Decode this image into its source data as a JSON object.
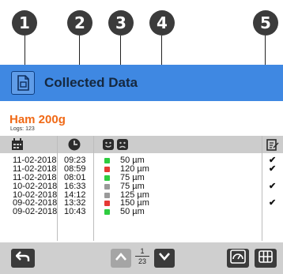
{
  "callouts": [
    "1",
    "2",
    "3",
    "4",
    "5"
  ],
  "title": "Collected Data",
  "product": {
    "name": "Ham 200g",
    "logs_label": "Logs: 123"
  },
  "table": {
    "header_icons": [
      "calendar-icon",
      "clock-icon",
      "smiley-icon",
      "frowny-icon",
      "edit-icon"
    ],
    "rows": [
      {
        "date": "11-02-2018",
        "time": "09:23",
        "status": "green",
        "value": "50 µm",
        "check": "✔"
      },
      {
        "date": "11-02-2018",
        "time": "08:59",
        "status": "red",
        "value": "120 µm",
        "check": "✔"
      },
      {
        "date": "11-02-2018",
        "time": "08:01",
        "status": "green",
        "value": "75 µm",
        "check": ""
      },
      {
        "date": "10-02-2018",
        "time": "16:33",
        "status": "gray",
        "value": "75 µm",
        "check": "✔"
      },
      {
        "date": "10-02-2018",
        "time": "14:12",
        "status": "gray",
        "value": "125 µm",
        "check": ""
      },
      {
        "date": "09-02-2018",
        "time": "13:32",
        "status": "red",
        "value": "150 µm",
        "check": "✔"
      },
      {
        "date": "09-02-2018",
        "time": "10:43",
        "status": "green",
        "value": "50 µm",
        "check": ""
      }
    ]
  },
  "pagination": {
    "current": "1",
    "total": "23"
  },
  "colors": {
    "titlebar": "#3f88e2",
    "product": "#f06a17",
    "green": "#2ecc40",
    "red": "#e53935",
    "gray": "#9a9a9a"
  }
}
